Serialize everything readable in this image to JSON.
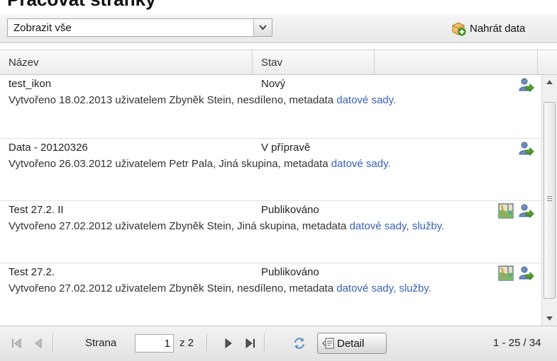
{
  "page": {
    "title": "Pracovat stránky"
  },
  "toolbar": {
    "filter_value": "Zobrazit vše",
    "upload_label": "Nahrát data"
  },
  "columns": {
    "name": "Název",
    "status": "Stav"
  },
  "rows": [
    {
      "name": "test_ikon",
      "status": "Nový",
      "desc_prefix": "Vytvořeno 18.02.2013 uživatelem Zbyněk Stein, nesdíleno, metadata ",
      "links": "datové sady.",
      "icons": [
        "share-icon"
      ]
    },
    {
      "name": "Data - 20120326",
      "status": "V přípravě",
      "desc_prefix": "Vytvořeno 26.03.2012 uživatelem Petr Pala, Jiná skupina, metadata ",
      "links": "datové sady.",
      "icons": [
        "share-icon"
      ]
    },
    {
      "name": "Test 27.2. II",
      "status": "Publikováno",
      "desc_prefix": "Vytvořeno 27.02.2012 uživatelem Zbyněk Stein, Jiná skupina, metadata ",
      "links": "datové sady, služby.",
      "icons": [
        "map-icon",
        "share-icon"
      ]
    },
    {
      "name": "Test 27.2.",
      "status": "Publikováno",
      "desc_prefix": "Vytvořeno 27.02.2012 uživatelem Zbyněk Stein, nesdíleno, metadata ",
      "links": "datové sady, služby.",
      "icons": [
        "map-icon",
        "share-icon"
      ]
    }
  ],
  "pager": {
    "page_label": "Strana",
    "page_value": "1",
    "of_label": "z 2",
    "detail_label": "Detail",
    "range_label": "1 - 25 / 34"
  },
  "colors": {
    "link": "#3a60b8",
    "upload_icon": "#e8a33a",
    "share_icon_green": "#5aa32a"
  }
}
